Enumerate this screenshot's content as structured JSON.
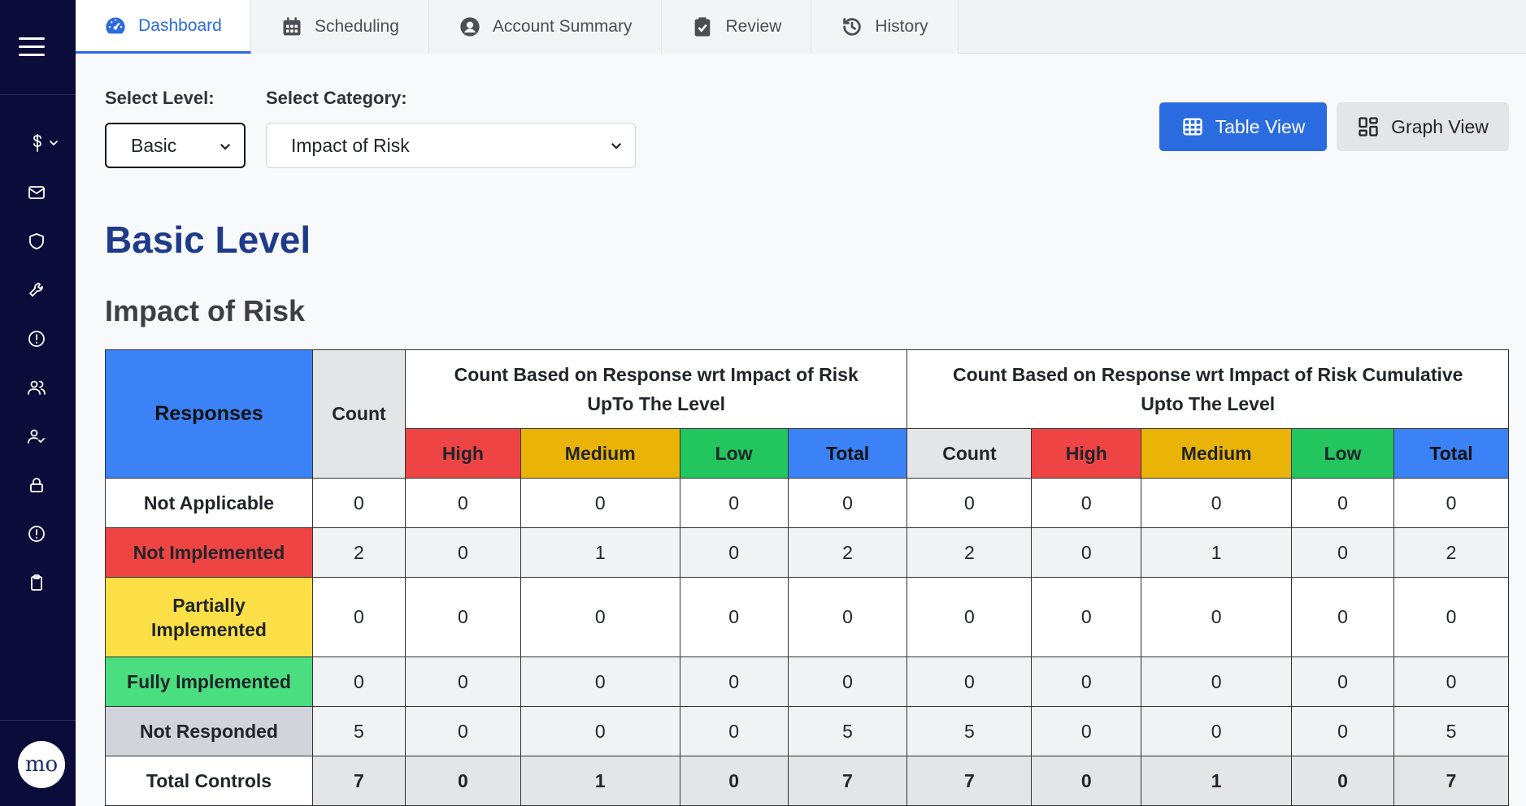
{
  "tabs": [
    {
      "label": "Dashboard",
      "icon": "gauge-icon"
    },
    {
      "label": "Scheduling",
      "icon": "calendar-icon"
    },
    {
      "label": "Account Summary",
      "icon": "user-circle-icon"
    },
    {
      "label": "Review",
      "icon": "clipboard-check-icon"
    },
    {
      "label": "History",
      "icon": "history-icon"
    }
  ],
  "sidebar": {
    "icons": [
      "dollar-icon",
      "mail-icon",
      "shield-icon",
      "wrench-icon",
      "alert-icon",
      "users-icon",
      "user-check-icon",
      "lock-icon",
      "alert-icon",
      "clipboard-icon"
    ],
    "avatar_text": "mo"
  },
  "filters": {
    "level_label": "Select Level:",
    "level_value": "Basic",
    "category_label": "Select Category:",
    "category_value": "Impact of Risk"
  },
  "views": {
    "table_label": "Table View",
    "graph_label": "Graph View"
  },
  "heading": "Basic Level",
  "subheading": "Impact of Risk",
  "table": {
    "col_responses": "Responses",
    "col_count": "Count",
    "group1": "Count Based on Response wrt Impact of Risk UpTo The Level",
    "group2": "Count Based on Response wrt Impact of Risk Cumulative Upto The Level",
    "sub_high": "High",
    "sub_medium": "Medium",
    "sub_low": "Low",
    "sub_total": "Total",
    "sub_count": "Count",
    "rows": [
      {
        "label": "Not Applicable",
        "values": [
          "0",
          "0",
          "0",
          "0",
          "0",
          "0",
          "0",
          "0",
          "0",
          "0"
        ]
      },
      {
        "label": "Not Implemented",
        "values": [
          "2",
          "0",
          "1",
          "0",
          "2",
          "2",
          "0",
          "1",
          "0",
          "2"
        ]
      },
      {
        "label": "Partially Implemented",
        "values": [
          "0",
          "0",
          "0",
          "0",
          "0",
          "0",
          "0",
          "0",
          "0",
          "0"
        ]
      },
      {
        "label": "Fully Implemented",
        "values": [
          "0",
          "0",
          "0",
          "0",
          "0",
          "0",
          "0",
          "0",
          "0",
          "0"
        ]
      },
      {
        "label": "Not Responded",
        "values": [
          "5",
          "0",
          "0",
          "0",
          "5",
          "5",
          "0",
          "0",
          "0",
          "5"
        ]
      },
      {
        "label": "Total Controls",
        "values": [
          "7",
          "0",
          "1",
          "0",
          "7",
          "7",
          "0",
          "1",
          "0",
          "7"
        ]
      }
    ]
  },
  "colors": {
    "sidebar": "#0b0c3a",
    "accent": "#2b6be0",
    "high": "#ef4444",
    "medium": "#eab308",
    "low": "#22c55e",
    "total": "#3b82f6"
  }
}
